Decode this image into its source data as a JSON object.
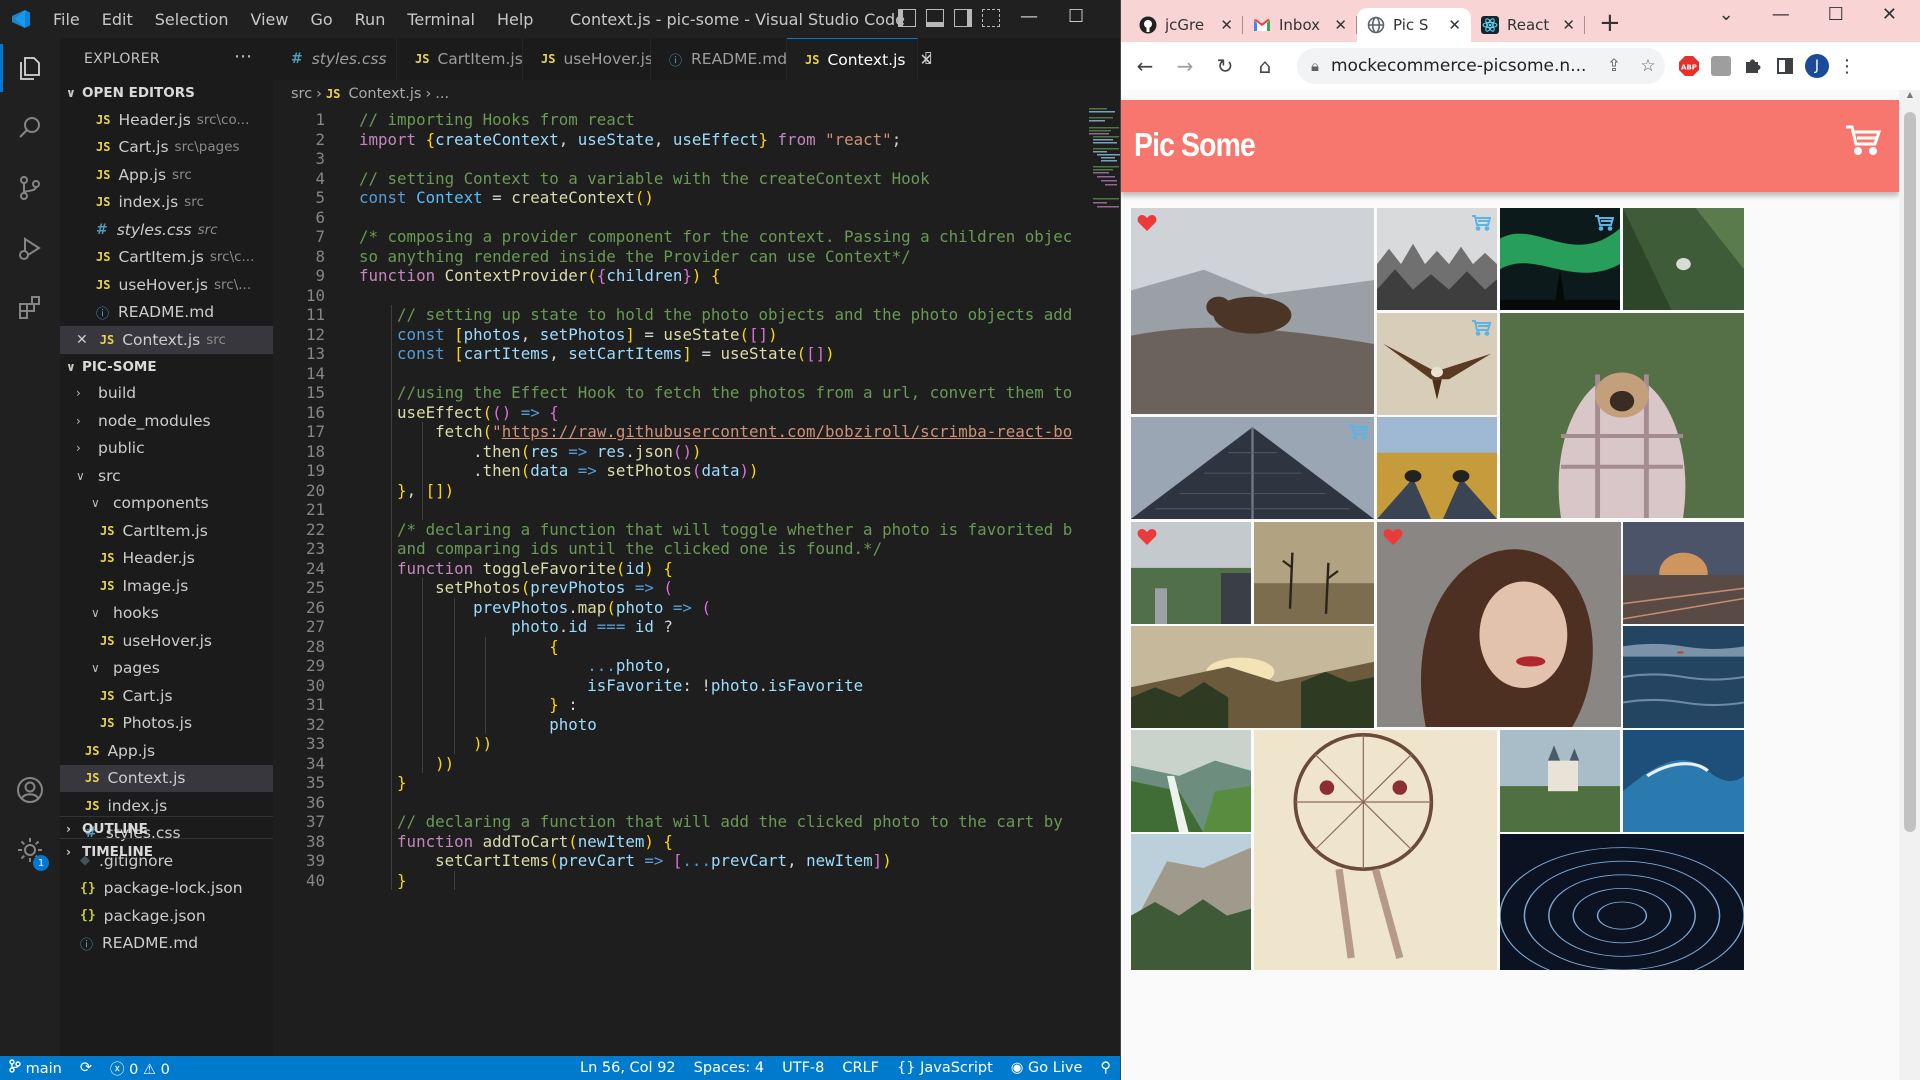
{
  "vscode": {
    "menu": [
      "File",
      "Edit",
      "Selection",
      "View",
      "Go",
      "Run",
      "Terminal",
      "Help"
    ],
    "window_title": "Context.js - pic-some - Visual Studio Code",
    "explorer_title": "EXPLORER",
    "open_editors_title": "OPEN EDITORS",
    "open_editors": [
      {
        "name": "Header.js",
        "desc": "src\\co...",
        "type": "js"
      },
      {
        "name": "Cart.js",
        "desc": "src\\pages",
        "type": "js"
      },
      {
        "name": "App.js",
        "desc": "src",
        "type": "js"
      },
      {
        "name": "index.js",
        "desc": "src",
        "type": "js"
      },
      {
        "name": "styles.css",
        "desc": "src",
        "type": "css"
      },
      {
        "name": "CartItem.js",
        "desc": "src\\c...",
        "type": "js"
      },
      {
        "name": "useHover.js",
        "desc": "src\\...",
        "type": "js"
      },
      {
        "name": "README.md",
        "desc": "",
        "type": "info"
      },
      {
        "name": "Context.js",
        "desc": "src",
        "type": "js"
      }
    ],
    "project_title": "PIC-SOME",
    "tree": [
      {
        "name": "build",
        "type": "folder",
        "open": false,
        "indent": 0
      },
      {
        "name": "node_modules",
        "type": "folder",
        "open": false,
        "indent": 0
      },
      {
        "name": "public",
        "type": "folder",
        "open": false,
        "indent": 0
      },
      {
        "name": "src",
        "type": "folder",
        "open": true,
        "indent": 0
      },
      {
        "name": "components",
        "type": "folder",
        "open": true,
        "indent": 1
      },
      {
        "name": "CartItem.js",
        "type": "js",
        "indent": 2
      },
      {
        "name": "Header.js",
        "type": "js",
        "indent": 2
      },
      {
        "name": "Image.js",
        "type": "js",
        "indent": 2
      },
      {
        "name": "hooks",
        "type": "folder",
        "open": true,
        "indent": 1
      },
      {
        "name": "useHover.js",
        "type": "js",
        "indent": 2
      },
      {
        "name": "pages",
        "type": "folder",
        "open": true,
        "indent": 1
      },
      {
        "name": "Cart.js",
        "type": "js",
        "indent": 2
      },
      {
        "name": "Photos.js",
        "type": "js",
        "indent": 2
      },
      {
        "name": "App.js",
        "type": "js",
        "indent": 1
      },
      {
        "name": "Context.js",
        "type": "js",
        "indent": 1
      },
      {
        "name": "index.js",
        "type": "js",
        "indent": 1
      },
      {
        "name": "styles.css",
        "type": "css",
        "indent": 1
      },
      {
        "name": ".gitignore",
        "type": "git",
        "indent": 0
      },
      {
        "name": "package-lock.json",
        "type": "json",
        "indent": 0
      },
      {
        "name": "package.json",
        "type": "json",
        "indent": 0
      },
      {
        "name": "README.md",
        "type": "info",
        "indent": 0
      }
    ],
    "outline_title": "OUTLINE",
    "timeline_title": "TIMELINE",
    "tabs": [
      {
        "name": "styles.css",
        "type": "css"
      },
      {
        "name": "CartItem.js",
        "type": "js"
      },
      {
        "name": "useHover.js",
        "type": "js"
      },
      {
        "name": "README.md",
        "type": "info"
      },
      {
        "name": "Context.js",
        "type": "js"
      }
    ],
    "breadcrumb": [
      "src",
      "Context.js",
      "..."
    ],
    "code": [
      "// importing Hooks from react",
      "import {createContext, useState, useEffect} from \"react\";",
      "",
      "// setting Context to a variable with the createContext Hook",
      "const Context = createContext()",
      "",
      "/* composing a provider component for the context. Passing a children objec",
      "so anything rendered inside the Provider can use Context*/",
      "function ContextProvider({children}) {",
      "",
      "    // setting up state to hold the photo objects and the photo objects add",
      "    const [photos, setPhotos] = useState([])",
      "    const [cartItems, setCartItems] = useState([])",
      "",
      "    //using the Effect Hook to fetch the photos from a url, convert them to",
      "    useEffect(() => {",
      "        fetch(\"https://raw.githubusercontent.com/bobziroll/scrimba-react-bo",
      "            .then(res => res.json())",
      "            .then(data => setPhotos(data))",
      "    }, [])",
      "",
      "    /* declaring a function that will toggle whether a photo is favorited b",
      "    and comparing ids until the clicked one is found.*/",
      "    function toggleFavorite(id) {",
      "        setPhotos(prevPhotos => (",
      "            prevPhotos.map(photo => (",
      "                photo.id === id ?",
      "                    {",
      "                        ...photo,",
      "                        isFavorite: !photo.isFavorite",
      "                    } :",
      "                    photo",
      "            ))",
      "        ))",
      "    }",
      "",
      "    // declaring a function that will add the clicked photo to the cart by",
      "    function addToCart(newItem) {",
      "        setCartItems(prevCart => [...prevCart, newItem])",
      "    }"
    ],
    "status": {
      "branch": "main",
      "errors": "0",
      "warnings": "0",
      "position": "Ln 56, Col 92",
      "spaces": "Spaces: 4",
      "encoding": "UTF-8",
      "eol": "CRLF",
      "language": "JavaScript",
      "golive": "Go Live"
    },
    "settings_badge": "1"
  },
  "chrome": {
    "tabs": [
      {
        "label": "jcGre",
        "icon": "github-icon"
      },
      {
        "label": "Inbox",
        "icon": "gmail-icon"
      },
      {
        "label": "Pic S",
        "icon": "globe-icon",
        "active": true
      },
      {
        "label": "React",
        "icon": "react-icon"
      }
    ],
    "url": "mockecommerce-picsome.n...",
    "profile_initial": "J",
    "abp_label": "ABP"
  },
  "app": {
    "brand": "Pic Some",
    "accent": "#f7776e",
    "photos": [
      {
        "subject": "bear on rocks",
        "favorite": true,
        "in_cart": false,
        "color": "#8d8a86"
      },
      {
        "subject": "misty forest",
        "favorite": false,
        "in_cart": true,
        "color": "#b7b9ba"
      },
      {
        "subject": "aurora",
        "favorite": false,
        "in_cart": true,
        "color": "#1f6a3b"
      },
      {
        "subject": "pine tree",
        "favorite": false,
        "in_cart": false,
        "color": "#4e6e43"
      },
      {
        "subject": "eagle",
        "favorite": false,
        "in_cart": true,
        "color": "#c9b89a"
      },
      {
        "subject": "pug in blanket",
        "favorite": false,
        "in_cart": false,
        "color": "#6e8a55"
      },
      {
        "subject": "skyscraper",
        "favorite": false,
        "in_cart": true,
        "color": "#5b6270"
      },
      {
        "subject": "feet in field",
        "favorite": false,
        "in_cart": false,
        "color": "#b59647"
      },
      {
        "subject": "city park",
        "favorite": true,
        "in_cart": false,
        "color": "#8ca0a9"
      },
      {
        "subject": "dead trees",
        "favorite": false,
        "in_cart": false,
        "color": "#9b8b6a"
      },
      {
        "subject": "woman portrait",
        "favorite": true,
        "in_cart": false,
        "color": "#8b7369"
      },
      {
        "subject": "train tracks sunset",
        "favorite": false,
        "in_cart": false,
        "color": "#c37b4c"
      },
      {
        "subject": "valley sunset",
        "favorite": false,
        "in_cart": false,
        "color": "#8c7a58"
      },
      {
        "subject": "ocean",
        "favorite": false,
        "in_cart": false,
        "color": "#3c5c78"
      },
      {
        "subject": "waterfall",
        "favorite": false,
        "in_cart": false,
        "color": "#4f7a47"
      },
      {
        "subject": "dreamcatcher",
        "favorite": false,
        "in_cart": false,
        "color": "#e3d1b3"
      },
      {
        "subject": "castle",
        "favorite": false,
        "in_cart": false,
        "color": "#6d8a5e"
      },
      {
        "subject": "wave",
        "favorite": false,
        "in_cart": false,
        "color": "#2f6ea0"
      },
      {
        "subject": "cliffs",
        "favorite": false,
        "in_cart": false,
        "color": "#7a8f7c"
      },
      {
        "subject": "star trails",
        "favorite": false,
        "in_cart": false,
        "color": "#16253d"
      }
    ]
  }
}
